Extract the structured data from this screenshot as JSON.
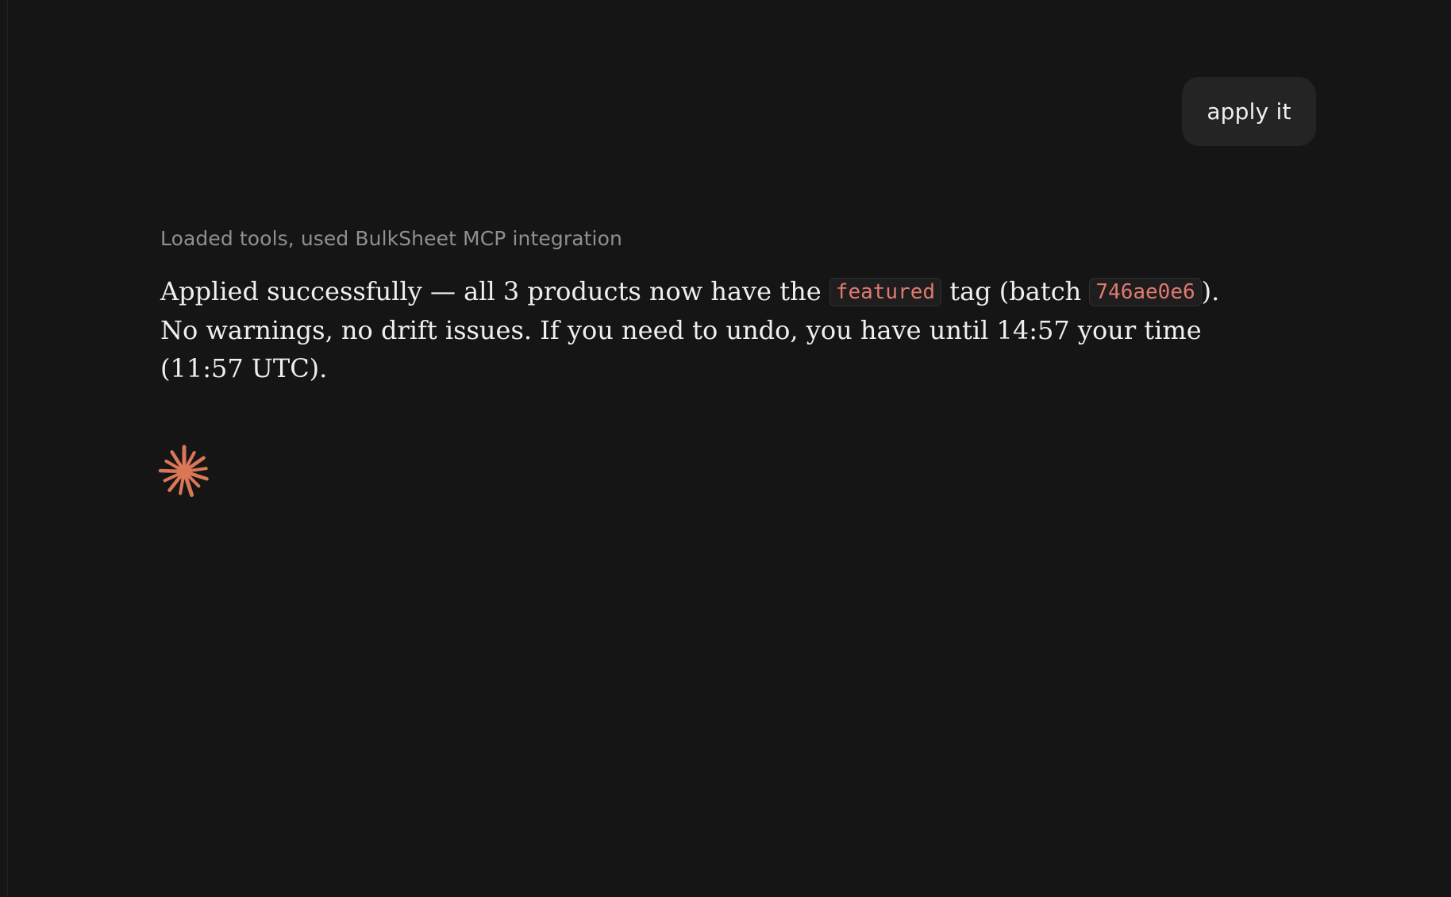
{
  "user_message": {
    "text": "apply it"
  },
  "assistant": {
    "tool_summary": "Loaded tools, used BulkSheet MCP integration",
    "message": {
      "part1": "Applied successfully — all 3 products now have the ",
      "code1": "featured",
      "part2": " tag (batch ",
      "code2": "746ae0e6",
      "part3": "). No warnings, no drift issues. If you need to undo, you have until 14:57 your time (11:57 UTC)."
    }
  },
  "status": {
    "icon": "spark-icon",
    "accent_color": "#d97757"
  },
  "colors": {
    "background": "#151515",
    "bubble": "#242424",
    "code_text": "#e07a70"
  }
}
